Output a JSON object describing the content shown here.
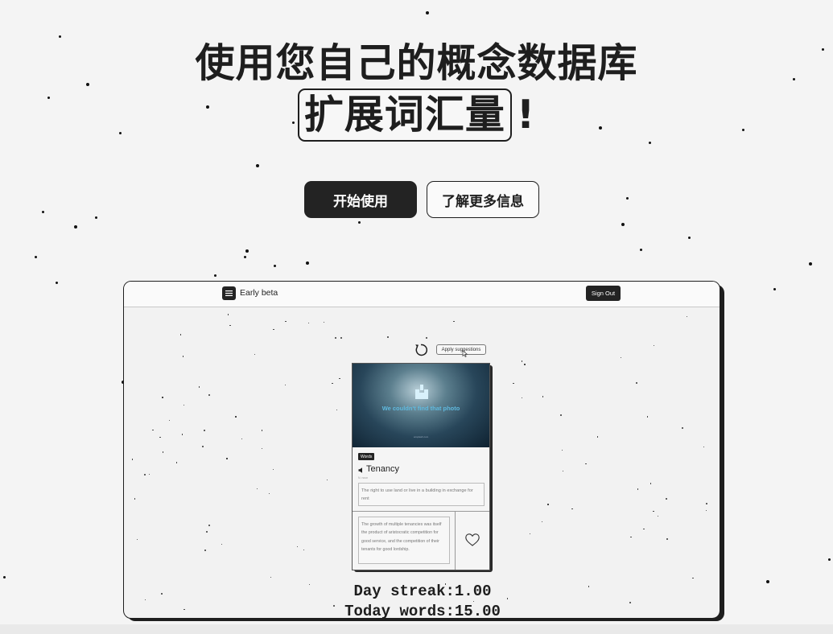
{
  "hero": {
    "title_line1": "使用您自己的概念数据库",
    "title_highlight": "扩展词汇量",
    "title_suffix": "!"
  },
  "buttons": {
    "primary_label": "开始使用",
    "secondary_label": "了解更多信息"
  },
  "app_preview": {
    "nav": {
      "brand_label": "Early beta",
      "sign_out_label": "Sign Out"
    },
    "toolbar": {
      "apply_label": "Apply suggestions"
    },
    "card": {
      "image_text": "We couldn't find that photo",
      "image_subtext": "unsplash.com",
      "badge": "Words",
      "word": "Tenancy",
      "part_of_speech": "N. noun",
      "definition": "The right to use land or live in a building in exchange for rent",
      "example": "The growth of multiple tenancies was itself the product of aristocratic competition for good service, and the competition of their tenants for good lordship."
    },
    "stats": {
      "day_streak": "Day streak:1.00",
      "today_words": "Today words:15.00"
    }
  },
  "colors": {
    "background": "#f4f4f4",
    "ink": "#1e1e1e",
    "primary_button": "#232323",
    "image_text": "#5fb9de"
  },
  "icons": [
    "menu-icon",
    "refresh-icon",
    "cursor-icon",
    "image-placeholder-icon",
    "speaker-icon",
    "heart-icon"
  ]
}
